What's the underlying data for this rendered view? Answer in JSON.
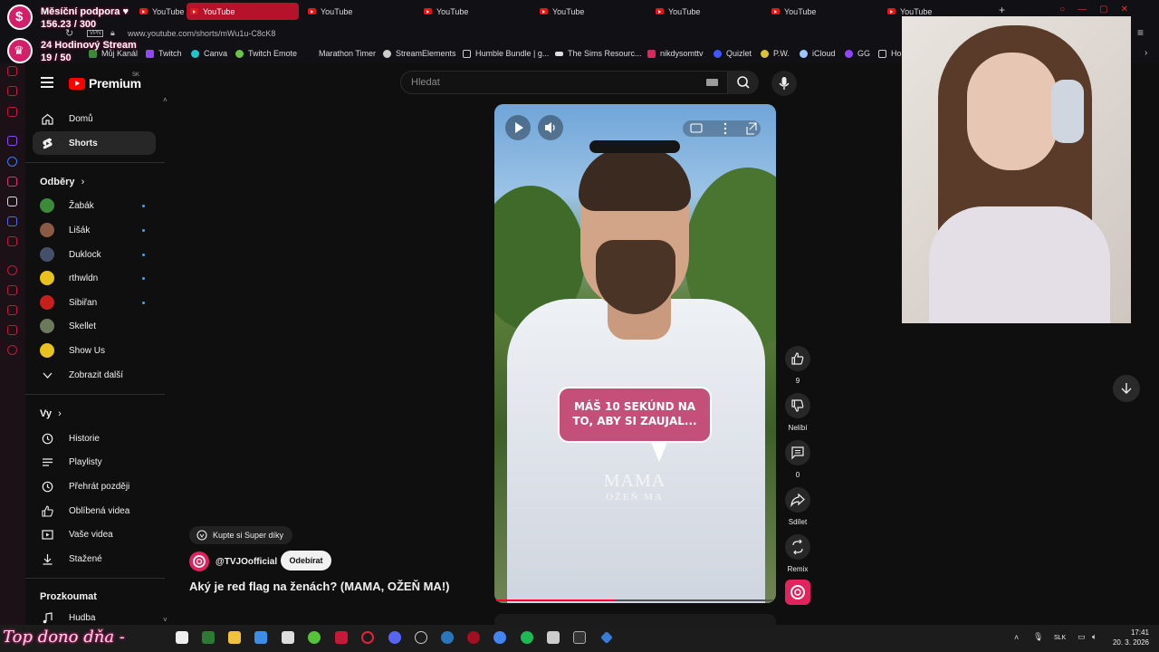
{
  "browser": {
    "tabs": [
      {
        "label": "YouTube",
        "active": false
      },
      {
        "label": "YouTube",
        "active": true
      },
      {
        "label": "YouTube",
        "active": false
      },
      {
        "label": "YouTube",
        "active": false
      },
      {
        "label": "YouTube",
        "active": false
      },
      {
        "label": "YouTube",
        "active": false
      },
      {
        "label": "YouTube",
        "active": false
      },
      {
        "label": "YouTube",
        "active": false
      }
    ],
    "url": "www.youtube.com/shorts/mWu1u-C8cK8",
    "vpn_badge": "VPN",
    "bookmarks": [
      "Můj Kanál",
      "Twitch",
      "Canva",
      "Twitch Emote",
      "Marathon Timer",
      "StreamElements",
      "Humble Bundle | g...",
      "The Sims Resourc...",
      "nikdysomttv",
      "Quizlet",
      "P.W.",
      "iCloud",
      "GG",
      "Ho"
    ]
  },
  "overlay": {
    "support_title": "Měsíční podpora",
    "support_value": "156.23 / 300",
    "stream_title": "24 Hodinový Stream",
    "stream_value": "19 / 50",
    "bottom_text": "Top dono dňa -"
  },
  "header": {
    "logo": "Premium",
    "region": "SK",
    "search_placeholder": "Hledat"
  },
  "sidebar": {
    "main": [
      {
        "label": "Domů",
        "icon": "home-icon",
        "active": false
      },
      {
        "label": "Shorts",
        "icon": "shorts-icon",
        "active": true
      }
    ],
    "subscriptions_title": "Odběry",
    "subscriptions": [
      {
        "label": "Žabák",
        "color": "#3c8a3a",
        "new": true
      },
      {
        "label": "Lišák",
        "color": "#8a5a44",
        "new": true
      },
      {
        "label": "Duklock",
        "color": "#44506a",
        "new": true
      },
      {
        "label": "rthwldn",
        "color": "#e6c21a",
        "new": true
      },
      {
        "label": "Sibiřan",
        "color": "#c81e1e",
        "new": true
      },
      {
        "label": "Skellet",
        "color": "#6b7a5a",
        "new": false
      },
      {
        "label": "Show Us",
        "color": "#e8c21d",
        "new": false
      }
    ],
    "show_more": "Zobrazit další",
    "you_title": "Vy",
    "you": [
      {
        "label": "Historie",
        "icon": "history-icon"
      },
      {
        "label": "Playlisty",
        "icon": "playlists-icon"
      },
      {
        "label": "Přehrát později",
        "icon": "watch-later-icon"
      },
      {
        "label": "Oblíbená videa",
        "icon": "liked-icon"
      },
      {
        "label": "Vaše videa",
        "icon": "your-videos-icon"
      },
      {
        "label": "Stažené",
        "icon": "downloads-icon"
      }
    ],
    "explore_title": "Prozkoumat",
    "explore": [
      {
        "label": "Hudba",
        "icon": "music-icon"
      }
    ]
  },
  "video": {
    "bubble_text": "MÁŠ 10 SEKÚND NA TO, ABY SI ZAUJAL...",
    "brand_line1": "MAMA",
    "brand_line2": "OŽEŇ MA",
    "progress": 0.43,
    "super_thanks": "Kupte si Super díky",
    "channel": "@TVJOofficial",
    "subscribe": "Odebírat",
    "title": "Aký je red flag na ženách? (MAMA, OŽEŇ MA!)"
  },
  "actions": {
    "like_count": "9",
    "dislike_label": "Nelíbí",
    "comments_count": "0",
    "share_label": "Sdílet",
    "remix_label": "Remix"
  },
  "taskbar": {
    "lang": "SLK",
    "time": "17:41",
    "date": "20. 3. 2026"
  },
  "colors": {
    "yt_red": "#ff0000",
    "accent_pink": "#e0245e",
    "active_tab": "#b5132b"
  }
}
